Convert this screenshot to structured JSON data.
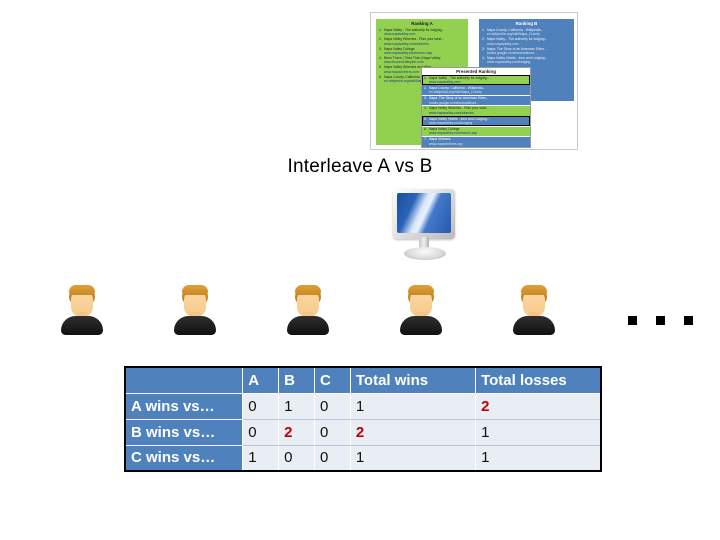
{
  "caption": "Interleave A vs B",
  "colors": {
    "accent_blue": "#4F81BD",
    "ranking_a_green": "#92D050",
    "cell_background": "#E9EDF4",
    "highlight_red": "#C00000"
  },
  "diagram": {
    "ranking_a": {
      "title": "Ranking A",
      "items": [
        {
          "n": "1.",
          "title": "Napa Valley - The authority for lodging...",
          "url": "www.napavalley.com"
        },
        {
          "n": "2.",
          "title": "Napa Valley Wineries - Plan your wine...",
          "url": "www.napavalley.com/wineries"
        },
        {
          "n": "3.",
          "title": "Napa Valley College",
          "url": "www.napavalley.edu/homex.asp"
        },
        {
          "n": "4.",
          "title": "Been There | Tried That | Napa Valley",
          "url": "www.brownsvalleyinn.com"
        },
        {
          "n": "5.",
          "title": "Napa Valley Wineries and Wine",
          "url": "www.napavintners.com"
        },
        {
          "n": "6.",
          "title": "Napa County, California - Wikipedia...",
          "url": "en.wikipedia.org/wiki/Napa_County"
        }
      ]
    },
    "ranking_b": {
      "title": "Ranking B",
      "items": [
        {
          "n": "1.",
          "title": "Napa County, California - Wikipedia...",
          "url": "en.wikipedia.org/wiki/Napa_County"
        },
        {
          "n": "2.",
          "title": "Napa Valley - The authority for lodging...",
          "url": "www.napavalley.com"
        },
        {
          "n": "3.",
          "title": "Napa: The Story of an American Eden...",
          "url": "books.google.com/books/about..."
        },
        {
          "n": "4.",
          "title": "Napa Valley Hotels - Inns and Lodging...",
          "url": "www.napavalley.com/lodging"
        }
      ]
    },
    "presented_ranking": {
      "title": "Presented Ranking",
      "items": [
        {
          "n": "1.",
          "title": "Napa Valley - The authority for lodging...",
          "url": "www.napavalley.com",
          "source": "a",
          "clicked": true
        },
        {
          "n": "2.",
          "title": "Napa County, California - Wikipedia...",
          "url": "en.wikipedia.org/wiki/Napa_County",
          "source": "b",
          "clicked": false
        },
        {
          "n": "3.",
          "title": "Napa: The Story of an American Eden...",
          "url": "books.google.com/books/about...",
          "source": "b",
          "clicked": false
        },
        {
          "n": "4.",
          "title": "Napa Valley Wineries - Plan your wine...",
          "url": "www.napavalley.com/wineries",
          "source": "a",
          "clicked": false
        },
        {
          "n": "5.",
          "title": "Napa Valley Hotels - Inns and Lodging...",
          "url": "www.napavalley.com/lodging",
          "source": "b",
          "clicked": true
        },
        {
          "n": "6.",
          "title": "Napa Valley College",
          "url": "www.napavalley.edu/homex.asp",
          "source": "a",
          "clicked": false
        },
        {
          "n": "7.",
          "title": "Napa Vintners",
          "url": "www.napavintners.org",
          "source": "b",
          "clicked": false
        }
      ]
    }
  },
  "people": {
    "count": 5,
    "ellipsis": "..."
  },
  "table": {
    "headers": [
      "",
      "A",
      "B",
      "C",
      "Total wins",
      "Total losses"
    ],
    "rows": [
      {
        "label": "A wins vs…",
        "cells": [
          {
            "value": "0",
            "highlight": false
          },
          {
            "value": "1",
            "highlight": false
          },
          {
            "value": "0",
            "highlight": false
          },
          {
            "value": "1",
            "highlight": false
          },
          {
            "value": "2",
            "highlight": true
          }
        ]
      },
      {
        "label": "B wins vs…",
        "cells": [
          {
            "value": "0",
            "highlight": false
          },
          {
            "value": "2",
            "highlight": true
          },
          {
            "value": "0",
            "highlight": false
          },
          {
            "value": "2",
            "highlight": true
          },
          {
            "value": "1",
            "highlight": false
          }
        ]
      },
      {
        "label": "C wins vs…",
        "cells": [
          {
            "value": "1",
            "highlight": false
          },
          {
            "value": "0",
            "highlight": false
          },
          {
            "value": "0",
            "highlight": false
          },
          {
            "value": "1",
            "highlight": false
          },
          {
            "value": "1",
            "highlight": false
          }
        ]
      }
    ]
  }
}
